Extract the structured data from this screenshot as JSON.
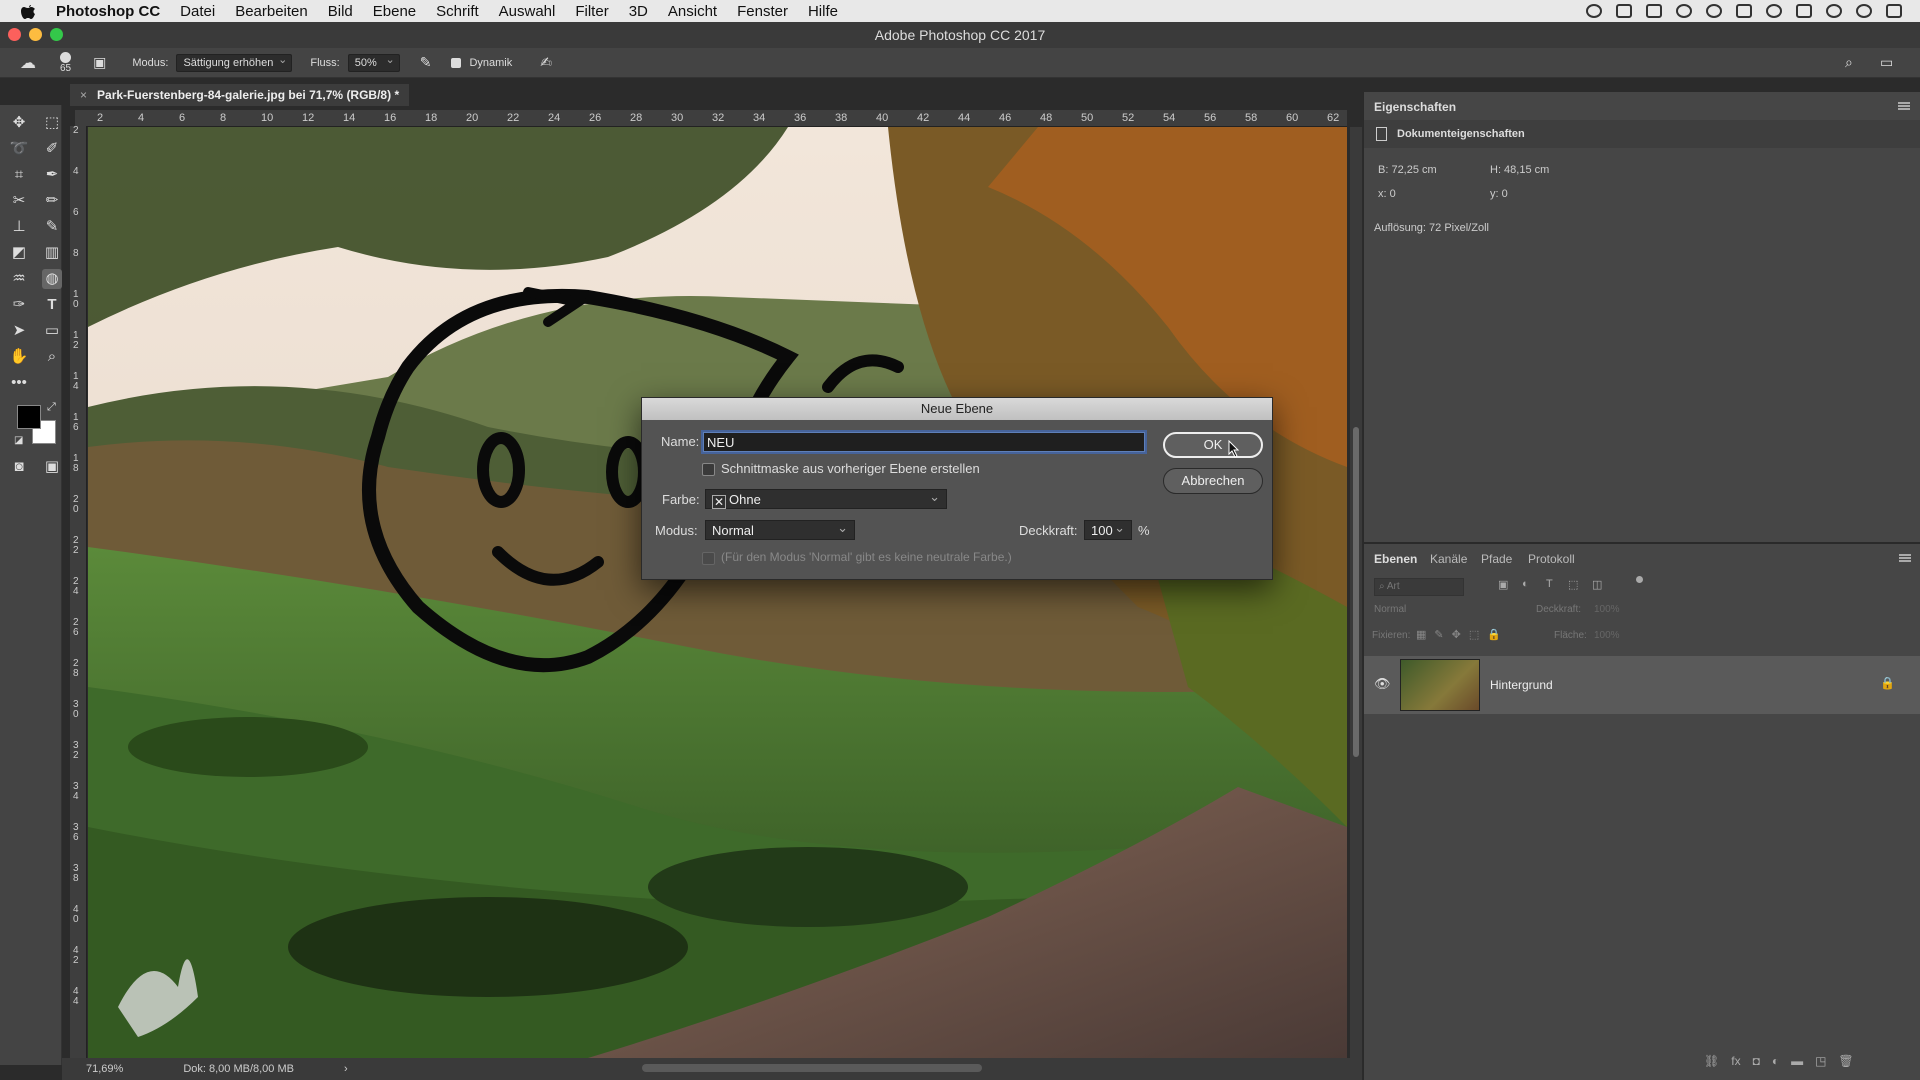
{
  "menubar": {
    "app": "Photoshop CC",
    "items": [
      "Datei",
      "Bearbeiten",
      "Bild",
      "Ebene",
      "Schrift",
      "Auswahl",
      "Filter",
      "3D",
      "Ansicht",
      "Fenster",
      "Hilfe"
    ]
  },
  "window": {
    "title": "Adobe Photoshop CC 2017"
  },
  "options": {
    "brush_size": "65",
    "mode_label": "Modus:",
    "mode_value": "Sättigung erhöhen",
    "flow_label": "Fluss:",
    "flow_value": "50%",
    "dynamic_label": "Dynamik"
  },
  "document": {
    "tab_title": "Park-Fuerstenberg-84-galerie.jpg bei 71,7% (RGB/8) *"
  },
  "ruler_h": [
    "2",
    "4",
    "6",
    "8",
    "10",
    "12",
    "14",
    "16",
    "18",
    "20",
    "22",
    "24",
    "26",
    "28",
    "30",
    "32",
    "34",
    "36",
    "38",
    "40",
    "42",
    "44",
    "46",
    "48",
    "50",
    "52",
    "54",
    "56",
    "58",
    "60",
    "62"
  ],
  "ruler_v": [
    "2",
    "4",
    "6",
    "8",
    "1 0",
    "1 2",
    "1 4",
    "1 6",
    "1 8",
    "2 0",
    "2 2",
    "2 4",
    "2 6",
    "2 8",
    "3 0",
    "3 2",
    "3 4",
    "3 6",
    "3 8",
    "4 0",
    "4 2",
    "4 4"
  ],
  "status": {
    "zoom": "71,69%",
    "doc": "Dok: 8,00 MB/8,00 MB",
    "arrow": "›"
  },
  "properties": {
    "tab": "Eigenschaften",
    "section": "Dokumenteigenschaften",
    "width": "B:  72,25 cm",
    "height": "H:  48,15 cm",
    "x": "x:  0",
    "y": "y:  0",
    "resolution": "Auflösung: 72 Pixel/Zoll"
  },
  "layers_panel": {
    "tabs": [
      "Ebenen",
      "Kanäle",
      "Pfade",
      "Protokoll"
    ],
    "search_placeholder": "Art",
    "blend": "Normal",
    "opacity_label": "Deckkraft:",
    "opacity_value": "100%",
    "lock_label": "Fixieren:",
    "fill_label": "Fläche:",
    "fill_value": "100%",
    "layer_name": "Hintergrund"
  },
  "dialog": {
    "title": "Neue Ebene",
    "name_label": "Name:",
    "name_value": "NEU",
    "clip_label": "Schnittmaske aus vorheriger Ebene erstellen",
    "color_label": "Farbe:",
    "color_value": "Ohne",
    "mode_label": "Modus:",
    "mode_value": "Normal",
    "opacity_label": "Deckkraft:",
    "opacity_value": "100",
    "percent": "%",
    "neutral_note": "(Für den Modus 'Normal' gibt es keine neutrale Farbe.)",
    "ok_label": "OK",
    "cancel_label": "Abbrechen"
  },
  "colors": {
    "accent": "#46639a",
    "panel": "#464646",
    "dialog": "#535353"
  }
}
